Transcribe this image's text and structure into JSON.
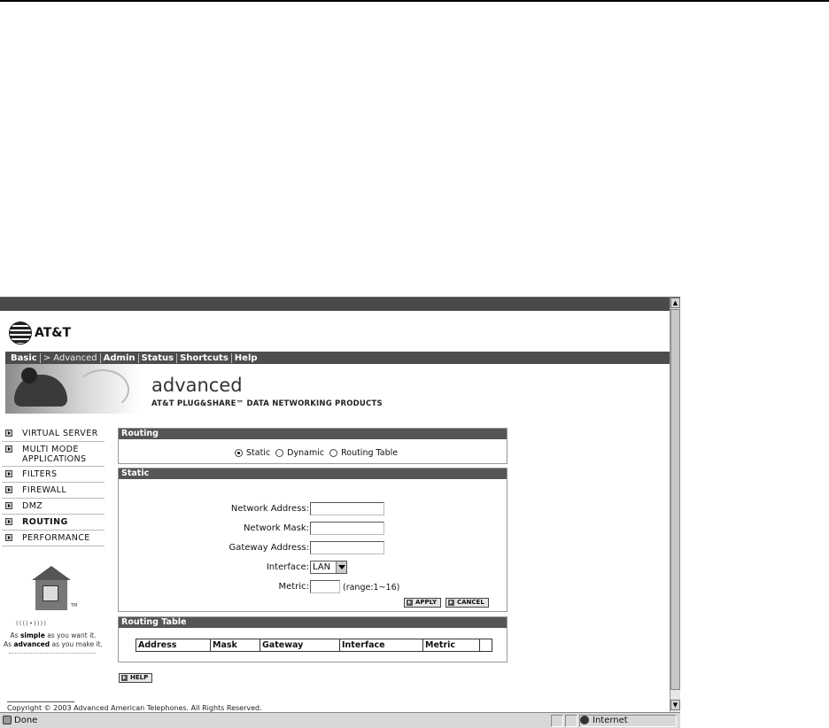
{
  "browser": {
    "status_text": "Done",
    "zone_text": "Internet"
  },
  "brand": {
    "logo_text": "AT&T"
  },
  "nav": {
    "items": [
      {
        "label": "Basic"
      },
      {
        "label": "> Advanced"
      },
      {
        "label": "Admin"
      },
      {
        "label": "Status"
      },
      {
        "label": "Shortcuts"
      },
      {
        "label": "Help"
      }
    ]
  },
  "banner": {
    "title": "advanced",
    "subtitle": "AT&T PLUG&SHARE™ DATA NETWORKING PRODUCTS"
  },
  "sidebar": {
    "items": [
      {
        "label": "VIRTUAL SERVER"
      },
      {
        "label": "MULTI MODE APPLICATIONS"
      },
      {
        "label": "FILTERS"
      },
      {
        "label": "FIREWALL"
      },
      {
        "label": "DMZ"
      },
      {
        "label": "ROUTING"
      },
      {
        "label": "PERFORMANCE"
      }
    ],
    "waves": "((((•))))",
    "tagline_pre1": "As ",
    "tagline_b1": "simple",
    "tagline_post1": " as you want it.",
    "tagline_pre2": "As ",
    "tagline_b2": "advanced",
    "tagline_post2": " as you make it.",
    "tm": "TM"
  },
  "routing": {
    "heading": "Routing",
    "options": [
      "Static",
      "Dynamic",
      "Routing Table"
    ],
    "selected": "Static"
  },
  "static": {
    "heading": "Static",
    "network_address_label": "Network Address:",
    "network_mask_label": "Network Mask:",
    "gateway_address_label": "Gateway Address:",
    "interface_label": "Interface:",
    "interface_value": "LAN",
    "metric_label": "Metric:",
    "metric_range": "(range:1~16)",
    "apply_label": "APPLY",
    "cancel_label": "CANCEL"
  },
  "routing_table": {
    "heading": "Routing Table",
    "columns": [
      "Address",
      "Mask",
      "Gateway",
      "Interface",
      "Metric",
      ""
    ]
  },
  "help_label": "HELP",
  "copyright": "Copyright © 2003 Advanced American Telephones. All Rights Reserved."
}
